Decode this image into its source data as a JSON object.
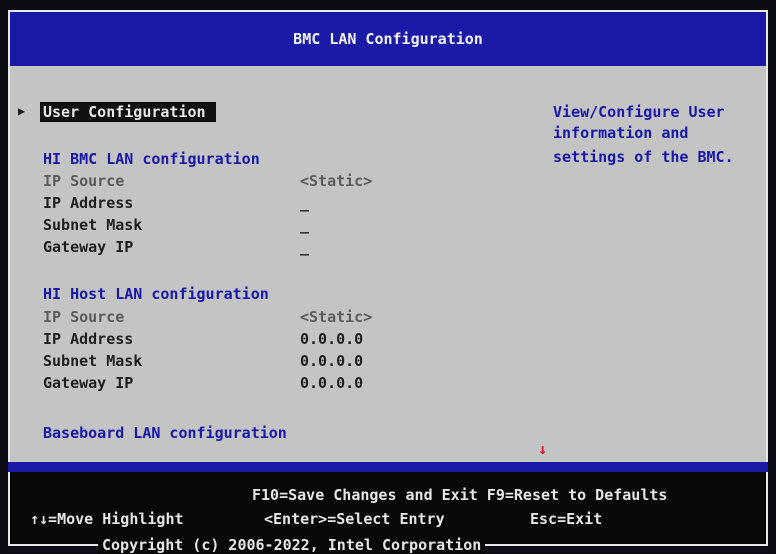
{
  "header": {
    "title": "BMC LAN Configuration"
  },
  "menu": {
    "selected_item": "User Configuration",
    "bmc_section_title": "HI BMC LAN configuration",
    "bmc_rows": [
      {
        "label": "IP Source",
        "value": "<Static>"
      },
      {
        "label": "IP Address",
        "value": "_"
      },
      {
        "label": "Subnet Mask",
        "value": "_"
      },
      {
        "label": "Gateway IP",
        "value": "_"
      }
    ],
    "host_section_title": "HI Host LAN configuration",
    "host_rows": [
      {
        "label": "IP Source",
        "value": "<Static>"
      },
      {
        "label": "IP Address",
        "value": "0.0.0.0"
      },
      {
        "label": "Subnet Mask",
        "value": "0.0.0.0"
      },
      {
        "label": "Gateway IP",
        "value": "0.0.0.0"
      }
    ],
    "baseboard_item": "Baseboard LAN configuration"
  },
  "help": {
    "lines": [
      "View/Configure User",
      "information and",
      "settings of the BMC."
    ]
  },
  "footer": {
    "line1": "F10=Save Changes and Exit F9=Reset to Defaults",
    "move": "↑↓=Move Highlight",
    "enter": "<Enter>=Select Entry",
    "esc": "Esc=Exit",
    "copyright": "Copyright (c) 2006-2022, Intel Corporation"
  },
  "icons": {
    "selector": "right-triangle-icon",
    "scroll": "down-arrow-icon"
  },
  "colors": {
    "header_bg": "#1a1aa6",
    "body_bg": "#c4c4c4",
    "help_text": "#1818a8",
    "scroll_arrow": "#d81818"
  }
}
